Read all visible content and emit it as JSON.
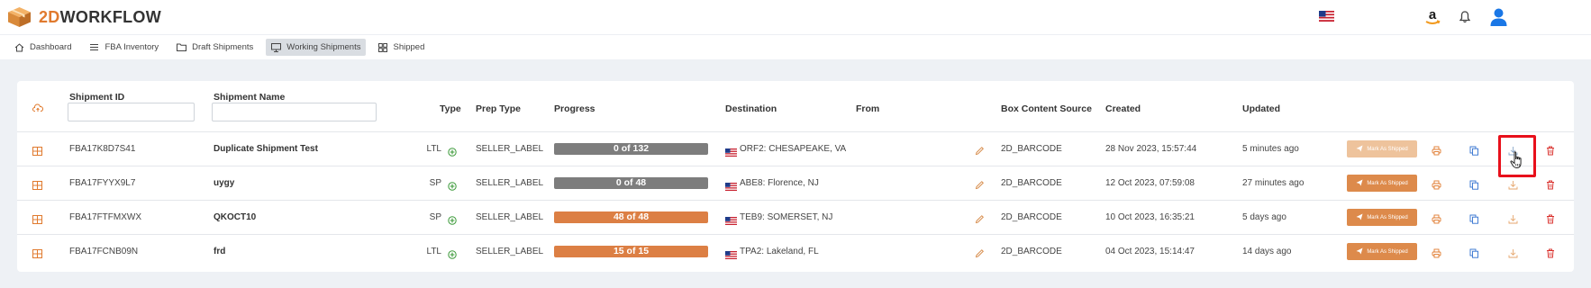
{
  "app": {
    "brand_prefix": "2D",
    "brand_suffix": "WORKFLOW"
  },
  "nav": {
    "items": [
      {
        "label": "Dashboard",
        "icon": "home-icon",
        "active": false
      },
      {
        "label": "FBA Inventory",
        "icon": "list-icon",
        "active": false
      },
      {
        "label": "Draft Shipments",
        "icon": "folder-icon",
        "active": false
      },
      {
        "label": "Working Shipments",
        "icon": "monitor-icon",
        "active": true
      },
      {
        "label": "Shipped",
        "icon": "grid-icon",
        "active": false
      }
    ]
  },
  "table": {
    "headers": {
      "shipment_id": "Shipment ID",
      "shipment_name": "Shipment Name",
      "type": "Type",
      "prep_type": "Prep Type",
      "progress": "Progress",
      "destination": "Destination",
      "from": "From",
      "box_content_source": "Box Content Source",
      "created": "Created",
      "updated": "Updated"
    },
    "filters": {
      "shipment_id_value": "",
      "shipment_name_value": ""
    },
    "mark_as_shipped_label": "Mark As Shipped",
    "rows": [
      {
        "shipment_id": "FBA17K8D7S41",
        "shipment_name": "Duplicate Shipment Test",
        "type": "LTL",
        "prep_type": "SELLER_LABEL",
        "progress_text": "0 of 132",
        "progress_fraction": 0,
        "destination": "ORF2: CHESAPEAKE, VA",
        "box_content_source": "2D_BARCODE",
        "created": "28 Nov 2023, 15:57:44",
        "updated": "5 minutes ago",
        "mark_enabled": false
      },
      {
        "shipment_id": "FBA17FYYX9L7",
        "shipment_name": "uygy",
        "type": "SP",
        "prep_type": "SELLER_LABEL",
        "progress_text": "0 of 48",
        "progress_fraction": 0,
        "destination": "ABE8: Florence, NJ",
        "box_content_source": "2D_BARCODE",
        "created": "12 Oct 2023, 07:59:08",
        "updated": "27 minutes ago",
        "mark_enabled": true
      },
      {
        "shipment_id": "FBA17FTFMXWX",
        "shipment_name": "QKOCT10",
        "type": "SP",
        "prep_type": "SELLER_LABEL",
        "progress_text": "48 of 48",
        "progress_fraction": 1,
        "destination": "TEB9: SOMERSET, NJ",
        "box_content_source": "2D_BARCODE",
        "created": "10 Oct 2023, 16:35:21",
        "updated": "5 days ago",
        "mark_enabled": true
      },
      {
        "shipment_id": "FBA17FCNB09N",
        "shipment_name": "frd",
        "type": "LTL",
        "prep_type": "SELLER_LABEL",
        "progress_text": "15 of 15",
        "progress_fraction": 1,
        "destination": "TPA2: Lakeland, FL",
        "box_content_source": "2D_BARCODE",
        "created": "04 Oct 2023, 15:14:47",
        "updated": "14 days ago",
        "mark_enabled": true
      }
    ]
  },
  "colors": {
    "accent": "#e07a2e",
    "progress_incomplete": "#7d7d7d",
    "progress_complete": "#dc7f44",
    "mark_enabled": "#dd8a4b",
    "mark_disabled": "#eec39c",
    "copy_icon": "#2f6fcf",
    "delete_icon": "#d9302c",
    "highlight": "#e8101b"
  },
  "icons": {
    "logo": "package-box-icon",
    "language": "us-flag-icon",
    "amazon": "amazon-icon",
    "notifications": "bell-icon",
    "user": "user-avatar-icon",
    "column_settings": "cloud-upload-icon",
    "row_expand": "grid-box-icon",
    "type_indicator": "plus-circle-icon",
    "destination_flag": "us-flag-icon",
    "edit": "pencil-icon",
    "print": "print-icon",
    "copy": "copy-icon",
    "download": "download-icon",
    "delete": "trash-icon",
    "cursor": "hand-cursor-icon"
  }
}
